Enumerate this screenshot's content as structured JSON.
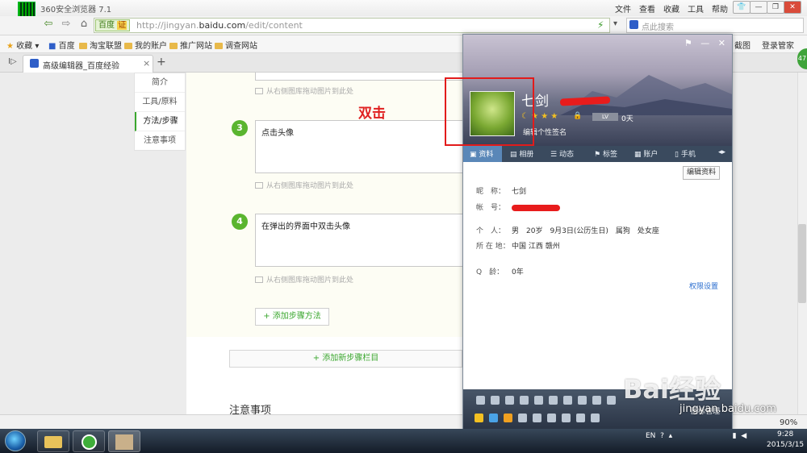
{
  "browser": {
    "title": "360安全浏览器 7.1",
    "menu": [
      "文件",
      "查看",
      "收藏",
      "工具",
      "帮助"
    ],
    "address": {
      "badge": "百度",
      "badge2": "证",
      "url_prefix": "http://jingyan.",
      "url_domain": "baidu.com",
      "url_suffix": "/edit/content"
    },
    "search_placeholder": "点此搜索",
    "bookmarks": [
      "收藏",
      "百度",
      "淘宝联盟",
      "我的账户",
      "推广网站",
      "调查网站"
    ],
    "bookmarks_right": [
      "截图",
      "登录管家"
    ],
    "tab_title": "高级编辑器_百度经验",
    "zoom": "90%"
  },
  "sidenav": [
    "简介",
    "工具/原料",
    "方法/步骤",
    "注意事项"
  ],
  "steps": [
    {
      "num": "3",
      "text": "点击头像"
    },
    {
      "num": "4",
      "text": "在弹出的界面中双击头像"
    }
  ],
  "image_hint": "从右侧图库拖动图片到此处",
  "add_method": "+ 添加步骤方法",
  "add_column": "+ 添加新步骤栏目",
  "notes_heading": "注意事项",
  "annotation": "双击",
  "qq": {
    "name": "七剑",
    "days": "0天",
    "level_icon": "LV",
    "signature": "编辑个性签名",
    "tabs": [
      "资料",
      "相册",
      "动态",
      "标签",
      "账户",
      "手机"
    ],
    "edit_button": "编辑资料",
    "fields": [
      {
        "label": "昵　称：",
        "value": "七剑"
      },
      {
        "label": "帐　号：",
        "value": ""
      },
      {
        "label": "个　人：",
        "value": "男　20岁　9月3日(公历生日)　属狗　处女座"
      },
      {
        "label": "所 在 地：",
        "value": "中国 江西 赣州"
      },
      {
        "label": "Q　龄：",
        "value": "0年"
      }
    ],
    "privacy": "权限设置",
    "bottom_text": "图标管理"
  },
  "watermark": "Bai经验",
  "watermark_url": "jingyan.baidu.com",
  "taskbar": {
    "lang": "EN",
    "time": "9:28",
    "date": "2015/3/15"
  }
}
